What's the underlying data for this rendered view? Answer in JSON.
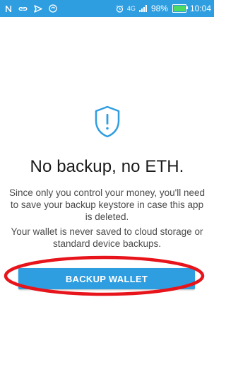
{
  "status_bar": {
    "net_type": "4G",
    "battery_percent_label": "98%",
    "battery_level": 0.98,
    "time": "10:04",
    "left_icons": [
      "notification-n-icon",
      "link-icon",
      "media-icon",
      "sync-icon"
    ],
    "right_icons": [
      "alarm-icon",
      "signal-icon",
      "battery-icon"
    ],
    "color": "#2f9ee0"
  },
  "main": {
    "icon": "shield-alert-icon",
    "title": "No backup, no ETH.",
    "paragraph_1": "Since only you control your money, you'll need to save your backup keystore in case this app is deleted.",
    "paragraph_2": "Your wallet is never saved to cloud storage or standard device backups."
  },
  "backup_button": {
    "label": "BACKUP WALLET",
    "color": "#2f9ee0"
  },
  "annotation": {
    "type": "red-ellipse-highlight",
    "color": "#e8141b"
  }
}
